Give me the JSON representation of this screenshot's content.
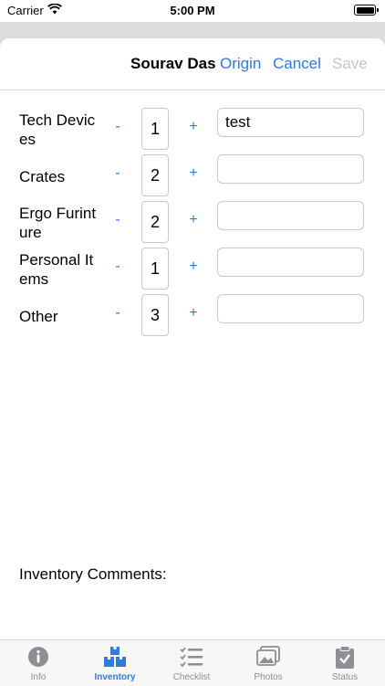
{
  "status_bar": {
    "carrier": "Carrier",
    "time": "5:00 PM"
  },
  "header": {
    "title": "Sourav Das",
    "origin": "Origin",
    "cancel": "Cancel",
    "save": "Save"
  },
  "rows": [
    {
      "label": "Tech Devices",
      "minus": "-",
      "quantity": "1",
      "plus": "+",
      "note": "test"
    },
    {
      "label": "Crates",
      "minus": "-",
      "quantity": "2",
      "plus": "+",
      "note": ""
    },
    {
      "label": "Ergo Furinture",
      "minus": "-",
      "quantity": "2",
      "plus": "+",
      "note": ""
    },
    {
      "label": "Personal Items",
      "minus": "-",
      "quantity": "1",
      "plus": "+",
      "note": ""
    },
    {
      "label": "Other",
      "minus": "-",
      "quantity": "3",
      "plus": "+",
      "note": ""
    }
  ],
  "comments_label": "Inventory Comments:",
  "tabs": [
    {
      "label": "Info",
      "icon": "info-icon",
      "active": false
    },
    {
      "label": "Inventory",
      "icon": "inventory-boxes-icon",
      "active": true
    },
    {
      "label": "Checklist",
      "icon": "checklist-icon",
      "active": false
    },
    {
      "label": "Photos",
      "icon": "photos-icon",
      "active": false
    },
    {
      "label": "Status",
      "icon": "status-clipboard-icon",
      "active": false
    }
  ],
  "colors": {
    "accent": "#2f7bd9",
    "disabled": "#c6c6c6",
    "inactive_tab": "#8e8e93"
  }
}
